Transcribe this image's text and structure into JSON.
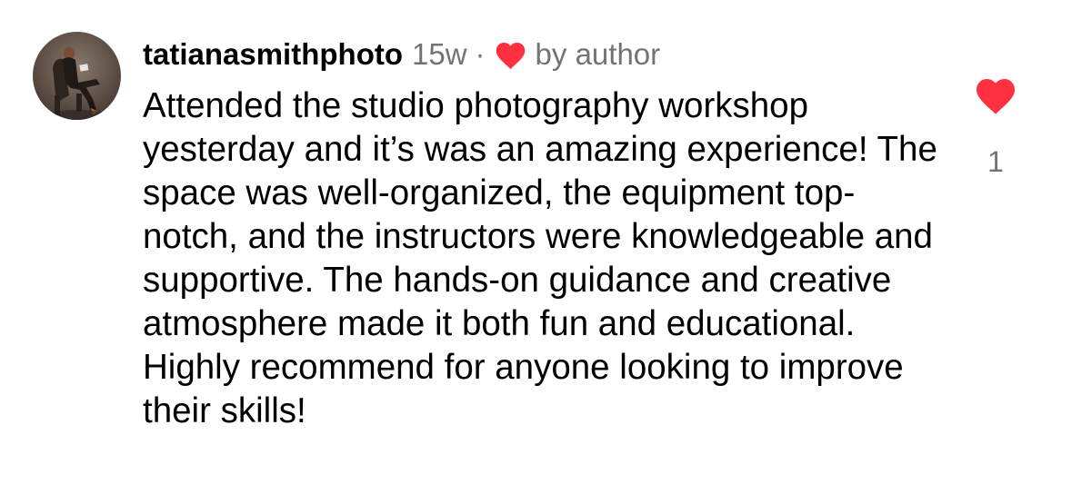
{
  "comment": {
    "username": "tatianasmithphoto",
    "timestamp": "15w",
    "separator": "·",
    "author_like_label": "by author",
    "text": "Attended the studio photography workshop yesterday and it’s was an amazing experience! The space was well-organized, the equipment top-notch, and the instructors were knowledgeable and supportive. The hands-on guidance and creative atmosphere made it both fun and educational. Highly recommend for anyone looking to improve their skills!",
    "like_count": "1",
    "liked": true
  },
  "icons": {
    "author_like": "heart-icon",
    "like_button": "heart-filled-icon"
  },
  "colors": {
    "heart": "#ff3040",
    "meta_text": "#737373",
    "text": "#000000"
  }
}
